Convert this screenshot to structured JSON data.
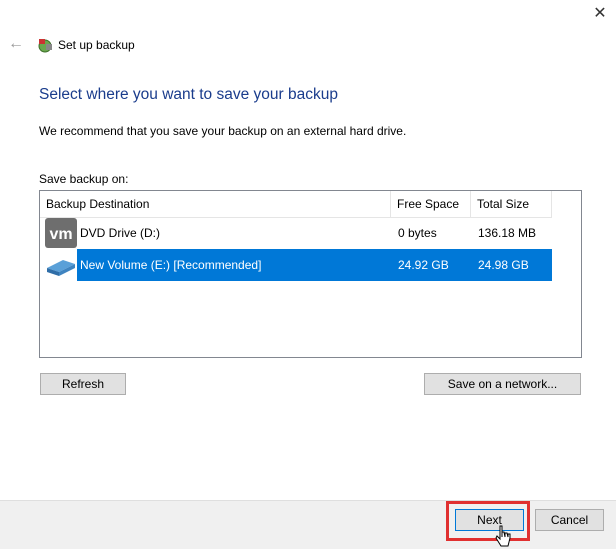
{
  "window": {
    "close_icon": "close-icon",
    "back_icon": "back-arrow-icon",
    "app_icon": "backup-wizard-icon",
    "title": "Set up backup"
  },
  "page": {
    "heading": "Select where you want to save your backup",
    "recommendation": "We recommend that you save your backup on an external hard drive.",
    "save_label": "Save backup on:"
  },
  "table": {
    "columns": [
      "Backup Destination",
      "Free Space",
      "Total Size"
    ],
    "rows": [
      {
        "icon": "dvd-drive-icon",
        "name": "DVD Drive (D:)",
        "free": "0 bytes",
        "total": "136.18 MB",
        "selected": false
      },
      {
        "icon": "usb-drive-icon",
        "name": "New Volume (E:) [Recommended]",
        "free": "24.92 GB",
        "total": "24.98 GB",
        "selected": true
      }
    ]
  },
  "buttons": {
    "refresh": "Refresh",
    "save_network": "Save on a network...",
    "next": "Next",
    "cancel": "Cancel"
  },
  "colors": {
    "heading": "#1a3c8c",
    "selection": "#0078d7",
    "highlight": "#e03030"
  }
}
